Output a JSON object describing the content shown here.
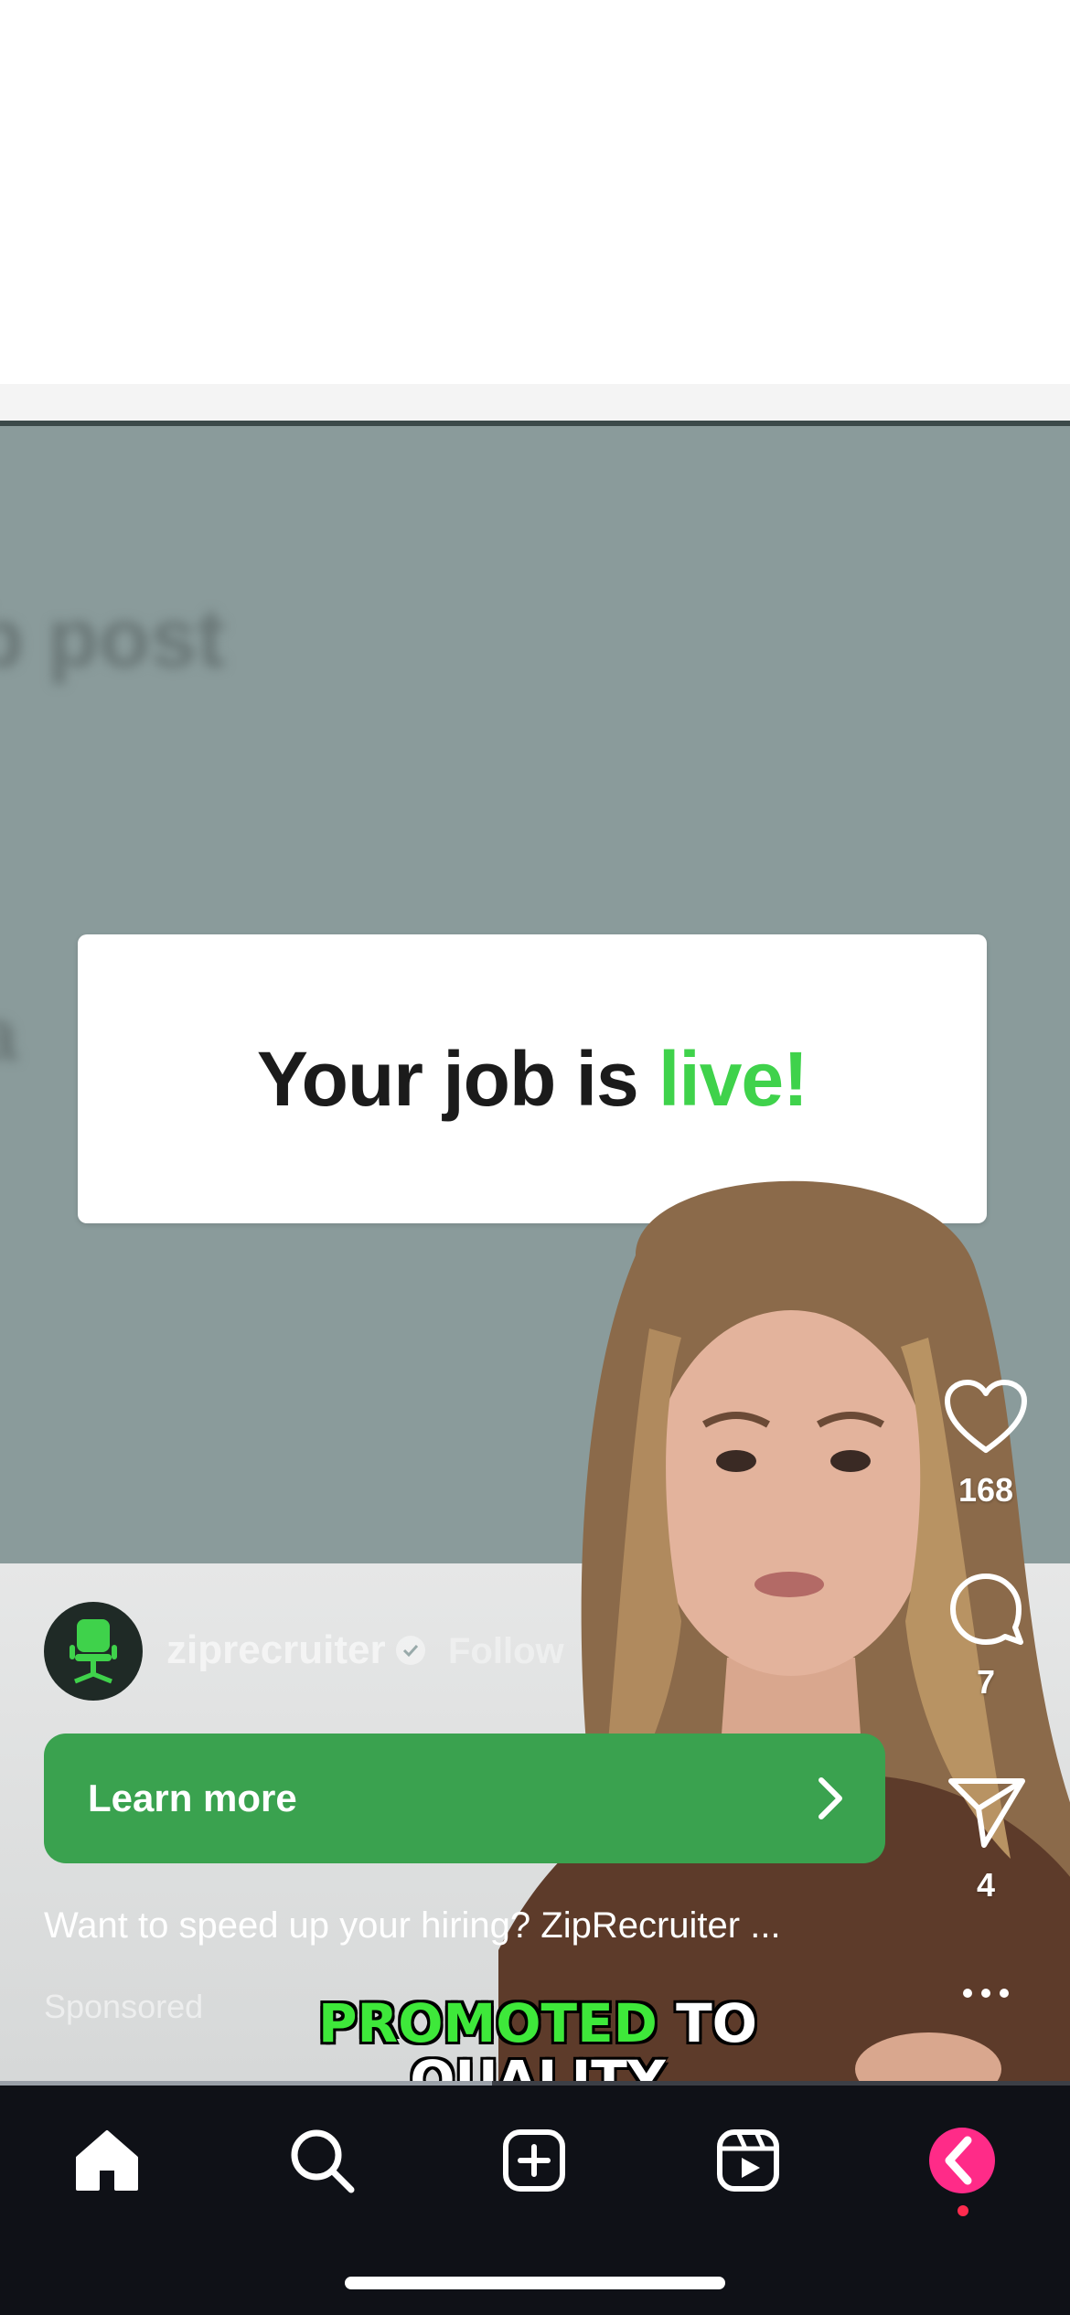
{
  "video": {
    "blurred_heading": "b post",
    "blurred_second": "xa",
    "card": {
      "text_main": "Your job is ",
      "text_accent": "live!"
    },
    "caption": {
      "line1_highlight": "PROMOTED",
      "line1_rest": " TO",
      "line2": "QUALITY"
    }
  },
  "post": {
    "account_name": "ziprecruiter",
    "follow_label": "Follow",
    "cta_label": "Learn more",
    "description": "Want to speed up your hiring? ZipRecruiter ...",
    "sponsored_label": "Sponsored"
  },
  "actions": {
    "likes": "168",
    "comments": "7",
    "shares": "4"
  },
  "progress": {
    "fraction": 0.46
  },
  "icons": {
    "home": "home-icon",
    "search": "search-icon",
    "create": "plus-square-icon",
    "reels": "reels-icon",
    "profile": "profile-icon",
    "like": "heart-icon",
    "comment": "comment-icon",
    "share": "send-icon",
    "more": "ellipsis-icon"
  },
  "colors": {
    "cta_green": "#3aa24f",
    "accent_green": "#3fd24b",
    "profile_pink": "#ff2b4e"
  }
}
